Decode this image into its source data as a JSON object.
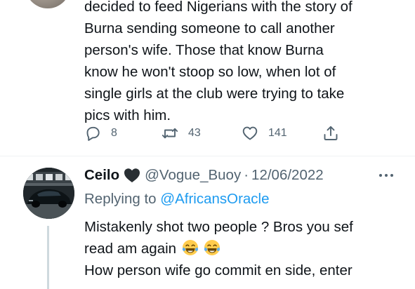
{
  "main_tweet": {
    "text_lines": [
      "decided to feed Nigerians with the story of",
      "Burna sending someone to call another",
      "person's wife. Those that know Burna",
      "know he won't stoop so low, when lot of",
      "single girls at the club were trying to take",
      "pics with him."
    ],
    "actions": {
      "replies": "8",
      "retweets": "43",
      "likes": "141"
    }
  },
  "reply_tweet": {
    "display_name": "Ceilo",
    "handle": "@Vogue_Buoy",
    "separator": "·",
    "date": "12/06/2022",
    "replying_prefix": "Replying to",
    "replying_to": "@AfricansOracle",
    "text_lines": [
      "Mistakenly shot two people ? Bros you sef",
      "read am again",
      "How person wife go commit en side, enter"
    ],
    "emojis": [
      "face-with-tears-of-joy",
      "face-with-tears-of-joy"
    ]
  },
  "colors": {
    "text": "#0f1419",
    "secondary": "#536471",
    "accent": "#1d9bf0",
    "divider": "#eff3f4",
    "thread_line": "#cfd9de"
  }
}
